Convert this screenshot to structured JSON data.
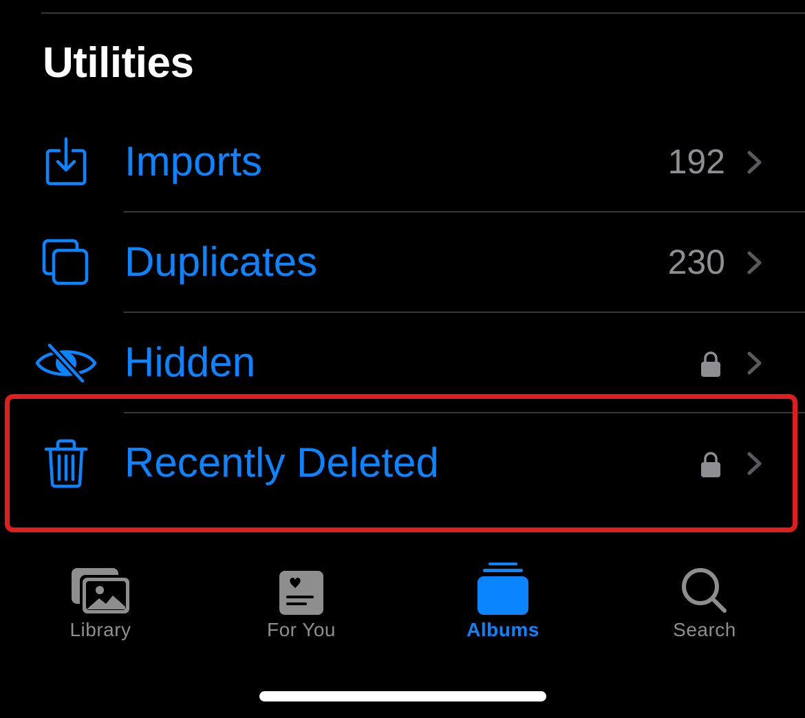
{
  "section": {
    "title": "Utilities"
  },
  "rows": [
    {
      "label": "Imports",
      "icon": "import-icon",
      "trailing": "count",
      "count": "192",
      "chevron": "chevron-right-icon"
    },
    {
      "label": "Duplicates",
      "icon": "duplicates-icon",
      "trailing": "count",
      "count": "230",
      "chevron": "chevron-right-icon"
    },
    {
      "label": "Hidden",
      "icon": "eye-slash-icon",
      "trailing": "lock",
      "lock": "lock-icon",
      "chevron": "chevron-right-icon"
    },
    {
      "label": "Recently Deleted",
      "icon": "trash-icon",
      "trailing": "lock",
      "lock": "lock-icon",
      "chevron": "chevron-right-icon",
      "highlighted": true
    }
  ],
  "tabbar": {
    "tabs": [
      {
        "label": "Library",
        "icon": "photo-stack-icon",
        "active": false
      },
      {
        "label": "For You",
        "icon": "for-you-icon",
        "active": false
      },
      {
        "label": "Albums",
        "icon": "albums-stack-icon",
        "active": true
      },
      {
        "label": "Search",
        "icon": "magnifying-glass-icon",
        "active": false
      }
    ]
  },
  "colors": {
    "accent": "#0a84ff",
    "background": "#000000",
    "secondary_text": "#8e8e93",
    "chevron": "#5a5a5e",
    "separator": "#38383a",
    "highlight": "#e01e1e",
    "inactive_tab": "#8e8e8e"
  }
}
